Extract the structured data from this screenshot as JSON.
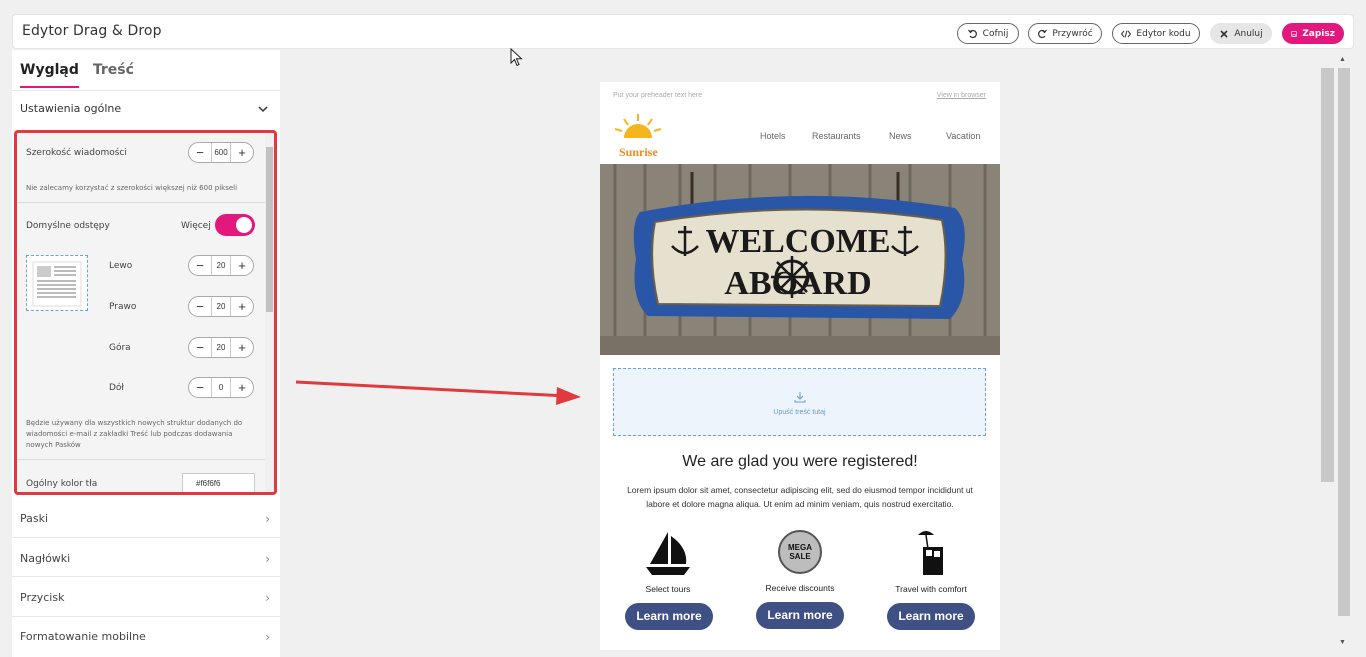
{
  "header": {
    "title": "Edytor Drag & Drop",
    "buttons": {
      "undo": "Cofnij",
      "redo": "Przywróć",
      "code": "Edytor kodu",
      "cancel": "Anuluj",
      "save": "Zapisz"
    }
  },
  "sidebar": {
    "tabs": [
      "Wygląd",
      "Treść"
    ],
    "section_title": "Ustawienia ogólne",
    "width": {
      "label": "Szerokość wiadomości",
      "value": "600",
      "hint": "Nie zalecamy korzystać z szerokości większej niż 600 pikseli"
    },
    "spacing": {
      "label": "Domyślne odstępy",
      "more_label": "Więcej",
      "toggle_on": true,
      "left": {
        "label": "Lewo",
        "value": "20"
      },
      "right": {
        "label": "Prawo",
        "value": "20"
      },
      "top": {
        "label": "Góra",
        "value": "20"
      },
      "bottom": {
        "label": "Dół",
        "value": "0"
      },
      "hint_lines": [
        "Będzie używany dla wszystkich nowych struktur dodanych do",
        "wiadomości e-mail z zakładki Treść lub podczas dodawania",
        "nowych Pasków"
      ]
    },
    "bg_color": {
      "label": "Ogólny kolor tła",
      "value": "#f6f6f6"
    },
    "accordion": [
      "Paski",
      "Nagłówki",
      "Przycisk",
      "Formatowanie mobilne"
    ]
  },
  "email": {
    "preheader": "Put your preheader text here",
    "view_in_browser": "View in browser",
    "logo_text": "Sunrise",
    "nav": [
      "Hotels",
      "Restaurants",
      "News",
      "Vacation"
    ],
    "hero_text_1": "WELCOME",
    "hero_text_2": "ABOARD",
    "drop_label": "Upuść treść tutaj",
    "headline": "We are glad you were registered!",
    "lorem_lines": [
      "Lorem ipsum dolor sit amet, consectetur adipiscing elit, sed do eiusmod tempor incididunt ut",
      "labore et dolore magna aliqua. Ut enim ad minim veniam, quis nostrud exercitatio."
    ],
    "features": [
      {
        "label": "Select tours",
        "button": "Learn more"
      },
      {
        "label": "Receive discounts",
        "button": "Learn more",
        "badge_1": "MEGA",
        "badge_2": "SALE"
      },
      {
        "label": "Travel with comfort",
        "button": "Learn more"
      }
    ]
  },
  "colors": {
    "accent": "#e2187f",
    "highlight": "#e03a3e",
    "button": "#3f5084"
  }
}
